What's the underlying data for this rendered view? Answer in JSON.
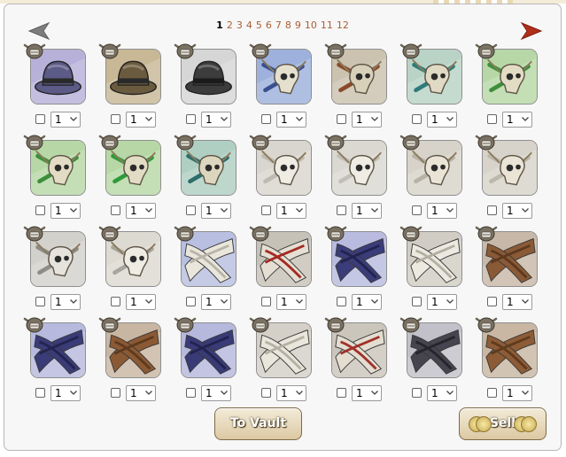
{
  "pagination": {
    "pages": [
      "1",
      "2",
      "3",
      "4",
      "5",
      "6",
      "7",
      "8",
      "9",
      "10",
      "11",
      "12"
    ],
    "current": "1",
    "prev_icon": "left-triangle-arrow",
    "next_icon": "right-triangle-arrow"
  },
  "items": [
    {
      "type": "hat",
      "color": "#5c5a86",
      "accent": "#2a2a2a",
      "bg": "#b7b1d9"
    },
    {
      "type": "hat",
      "color": "#6b5b3e",
      "accent": "#2a2a2a",
      "bg": "#c9b895"
    },
    {
      "type": "hat",
      "color": "#3c3c3c",
      "accent": "#1b1b1b",
      "bg": "#d6d6d6"
    },
    {
      "type": "skull",
      "color": "#e5dfce",
      "accent": "#3a4f8f",
      "bg": "#9eb1dc"
    },
    {
      "type": "skull",
      "color": "#d8d0b8",
      "accent": "#8a4b2b",
      "bg": "#cbc2b0"
    },
    {
      "type": "skull",
      "color": "#e0d9c4",
      "accent": "#2e7b7a",
      "bg": "#b9d3c6"
    },
    {
      "type": "skull",
      "color": "#e3dcc4",
      "accent": "#3d8f3a",
      "bg": "#b7d8a6"
    },
    {
      "type": "skull",
      "color": "#e3dcc4",
      "accent": "#3d8f3a",
      "bg": "#b7d8a6"
    },
    {
      "type": "skull",
      "color": "#e3dcc4",
      "accent": "#2f9a3a",
      "bg": "#b7d8a6"
    },
    {
      "type": "skull",
      "color": "#ddd6bf",
      "accent": "#2d6e6a",
      "bg": "#b0cfc3"
    },
    {
      "type": "skull",
      "color": "#efece4",
      "accent": "#bdbab2",
      "bg": "#d9d6cf"
    },
    {
      "type": "skull",
      "color": "#efece4",
      "accent": "#c2bfb6",
      "bg": "#dbd8d1"
    },
    {
      "type": "skull",
      "color": "#e9e4d6",
      "accent": "#b7b2a6",
      "bg": "#d7d3ca"
    },
    {
      "type": "skull",
      "color": "#e9e4d6",
      "accent": "#bdb8ac",
      "bg": "#d7d3ca"
    },
    {
      "type": "skull",
      "color": "#e6e3dc",
      "accent": "#8e8c86",
      "bg": "#d3d1cc"
    },
    {
      "type": "skull",
      "color": "#efece4",
      "accent": "#a8a59d",
      "bg": "#dddad2"
    },
    {
      "type": "wrap",
      "color": "#e9e6dc",
      "accent": "#b8b4a8",
      "bg": "#b9bfe0"
    },
    {
      "type": "wrap",
      "color": "#e4dfd2",
      "accent": "#a52a24",
      "bg": "#c7c2b7"
    },
    {
      "type": "wrap",
      "color": "#3b3d7a",
      "accent": "#22234f",
      "bg": "#b9bcdf"
    },
    {
      "type": "wrap",
      "color": "#ece9e0",
      "accent": "#b3afa3",
      "bg": "#d1cdc4"
    },
    {
      "type": "wrap",
      "color": "#8a5a36",
      "accent": "#5c391f",
      "bg": "#c8b8a7"
    },
    {
      "type": "wrap",
      "color": "#3a3c78",
      "accent": "#23244e",
      "bg": "#b7bade"
    },
    {
      "type": "wrap",
      "color": "#8b5a34",
      "accent": "#5e3a1e",
      "bg": "#c8b6a2"
    },
    {
      "type": "wrap",
      "color": "#393b77",
      "accent": "#22234e",
      "bg": "#b6b9dd"
    },
    {
      "type": "wrap",
      "color": "#e9e6dc",
      "accent": "#b4b0a4",
      "bg": "#d4d0c7"
    },
    {
      "type": "wrap",
      "color": "#e3ded1",
      "accent": "#a1322a",
      "bg": "#cbc6bb"
    },
    {
      "type": "wrap",
      "color": "#45444f",
      "accent": "#26252d",
      "bg": "#c2c1c9"
    },
    {
      "type": "wrap",
      "color": "#8d5c36",
      "accent": "#5f3b1f",
      "bg": "#c9b7a3"
    }
  ],
  "quantity_default": "1",
  "buttons": {
    "vault_label": "To Vault",
    "sell_label": "Sell"
  }
}
